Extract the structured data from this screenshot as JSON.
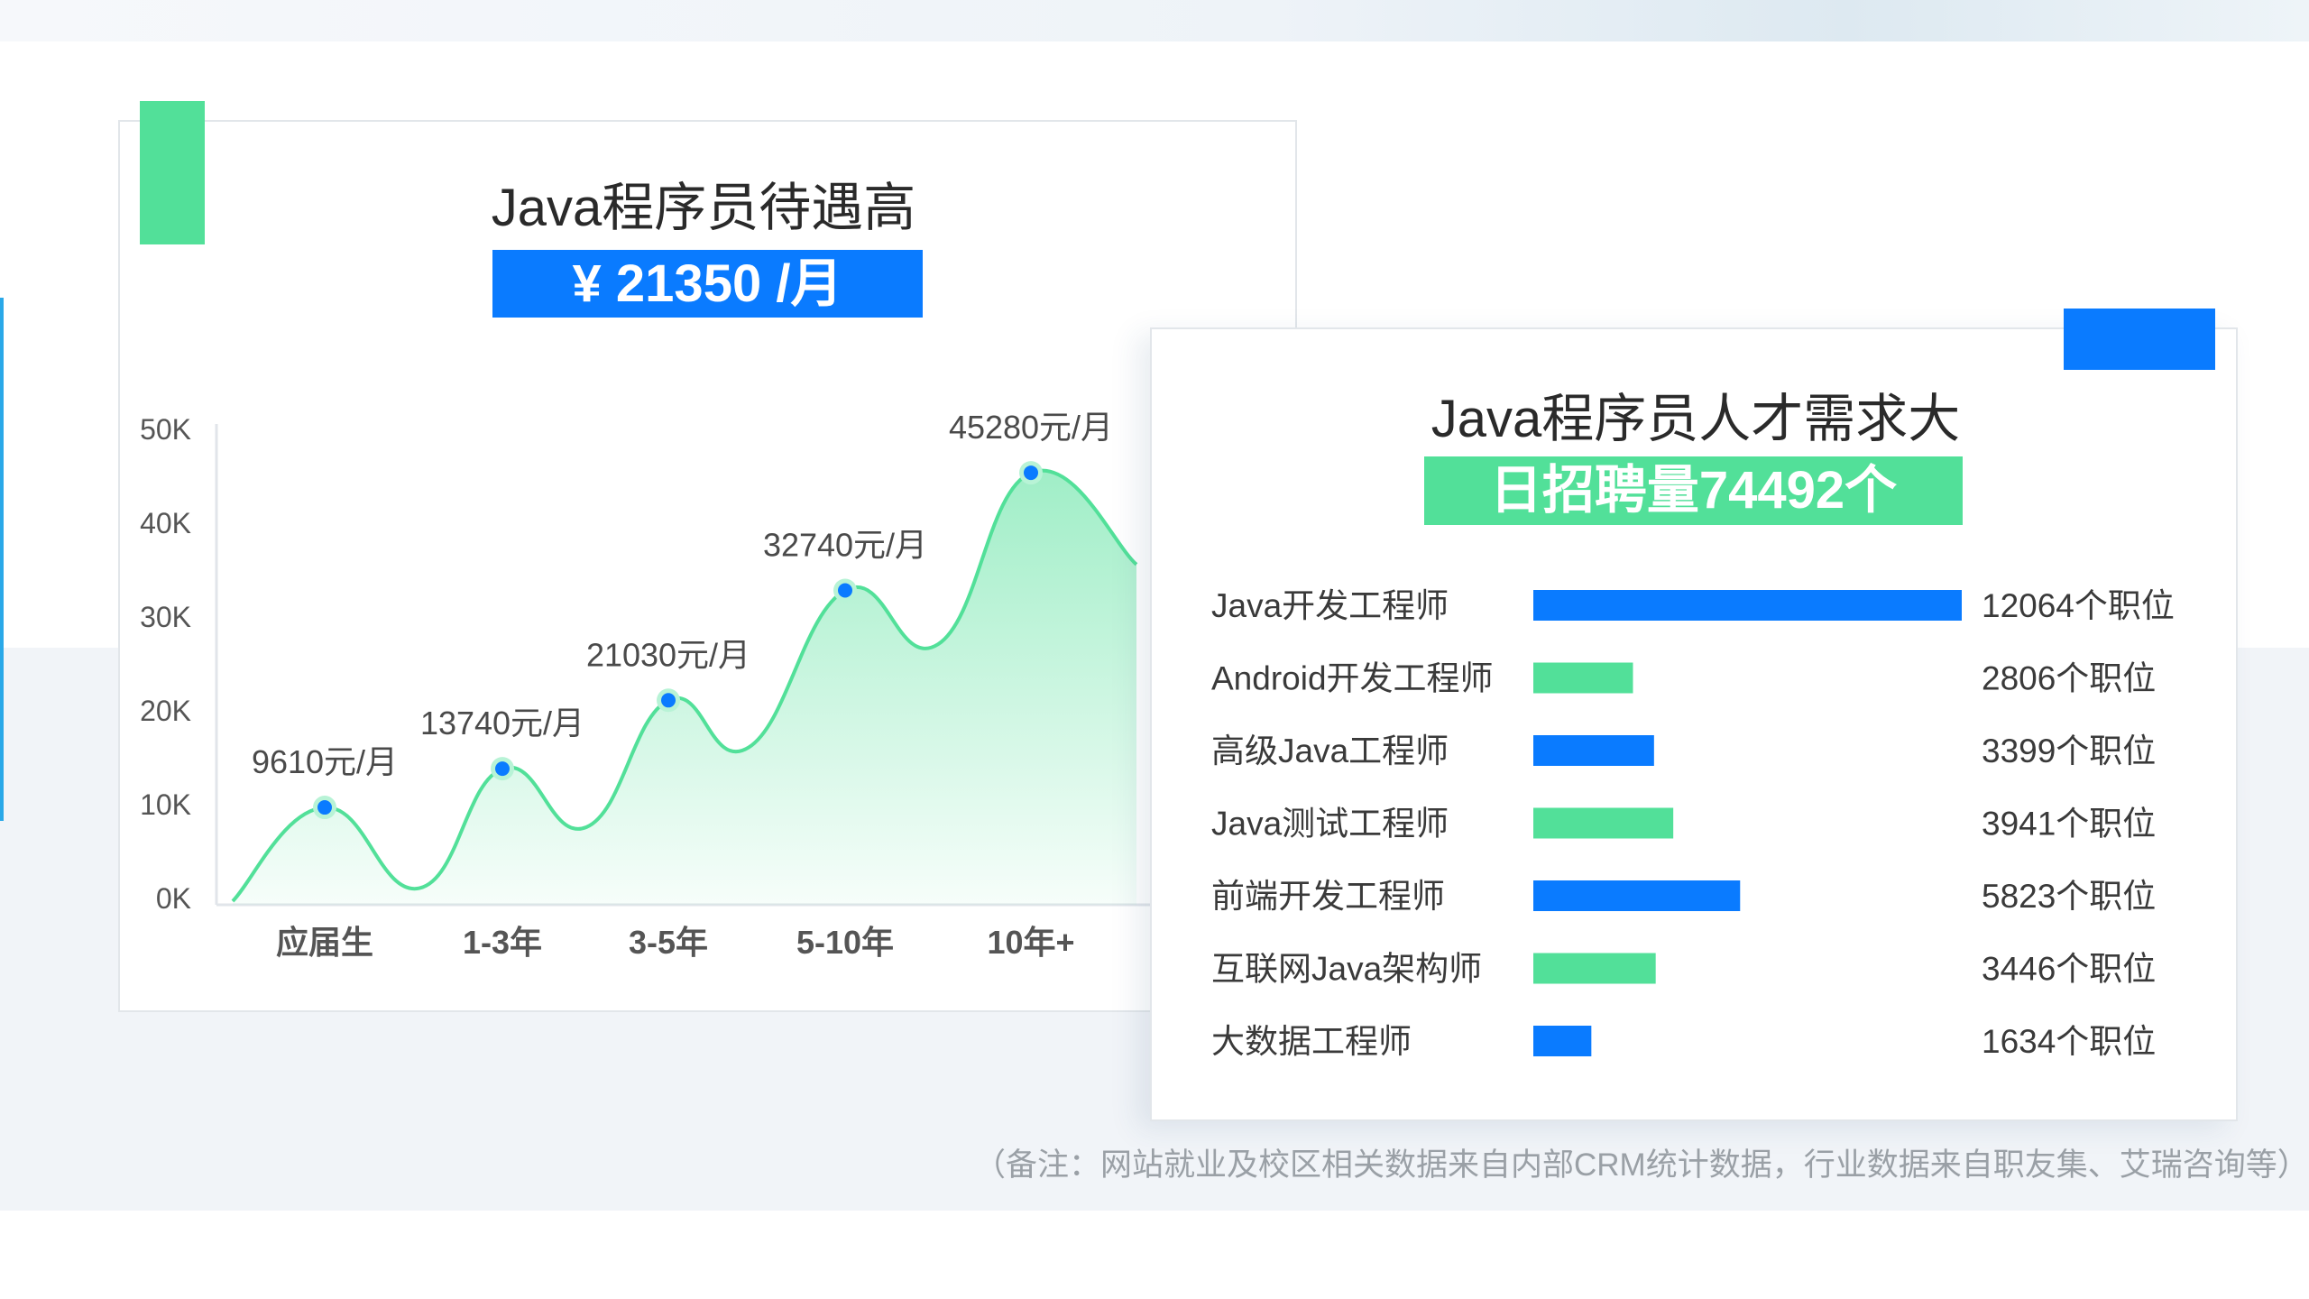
{
  "colors": {
    "green": "#52e099",
    "blue": "#0a7bff",
    "title_text": "#2a2a2a",
    "footnote_text": "#9aa0a6"
  },
  "salary_panel": {
    "title": "Java程序员待遇高",
    "average_label": "¥ 21350 /月"
  },
  "demand_panel": {
    "title": "Java程序员人才需求大",
    "daily_label": "日招聘量74492个"
  },
  "footnote": "（备注：网站就业及校区相关数据来自内部CRM统计数据，行业数据来自职友集、艾瑞咨询等）",
  "chart_data": [
    {
      "type": "area",
      "title": "",
      "xlabel": "",
      "ylabel": "",
      "categories": [
        "应届生",
        "1-3年",
        "3-5年",
        "5-10年",
        "10年+"
      ],
      "values": [
        9610,
        13740,
        21030,
        32740,
        45280
      ],
      "data_labels": [
        "9610元/月",
        "13740元/月",
        "21030元/月",
        "32740元/月",
        "45280元/月"
      ],
      "y_ticks": [
        "0K",
        "10K",
        "20K",
        "30K",
        "40K",
        "50K"
      ],
      "ylim": [
        0,
        50000
      ],
      "grid": false,
      "marker_color": "#0a7bff",
      "line_color": "#52e099"
    },
    {
      "type": "bar",
      "orientation": "horizontal",
      "title": "",
      "categories": [
        "Java开发工程师",
        "Android开发工程师",
        "高级Java工程师",
        "Java测试工程师",
        "前端开发工程师",
        "互联网Java架构师",
        "大数据工程师"
      ],
      "values": [
        12064,
        2806,
        3399,
        3941,
        5823,
        3446,
        1634
      ],
      "value_labels": [
        "12064个职位",
        "2806个职位",
        "3399个职位",
        "3941个职位",
        "5823个职位",
        "3446个职位",
        "1634个职位"
      ],
      "bar_colors": [
        "#0a7bff",
        "#52e099",
        "#0a7bff",
        "#52e099",
        "#0a7bff",
        "#52e099",
        "#0a7bff"
      ],
      "grid": false
    }
  ]
}
